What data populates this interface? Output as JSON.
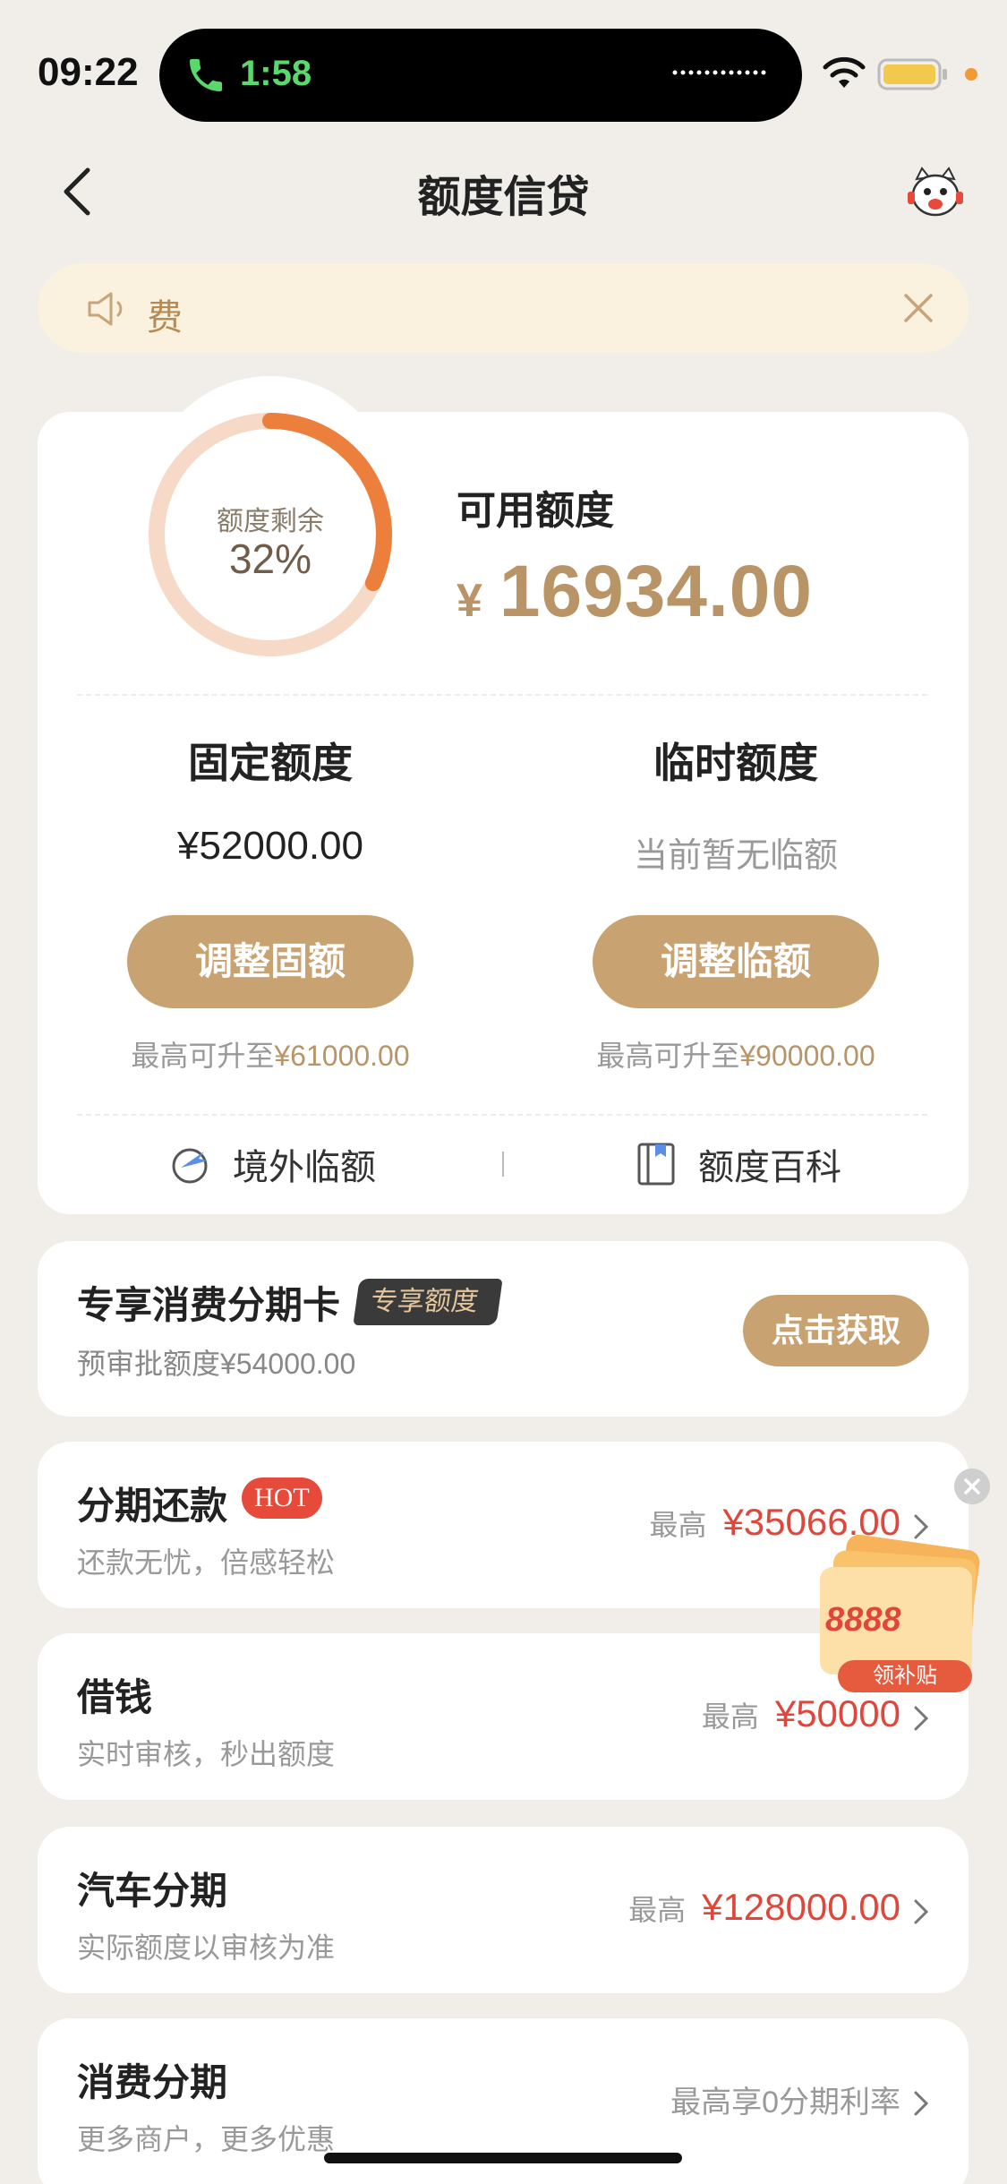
{
  "status_bar": {
    "time": "09:22",
    "call_duration": "1:58"
  },
  "header": {
    "title": "额度信贷"
  },
  "notice": {
    "text": "费"
  },
  "credit": {
    "ring_label": "额度剩余",
    "ring_percent_text": "32%",
    "ring_fraction": 0.32,
    "available_label": "可用额度",
    "available_currency": "¥",
    "available_amount": "16934.00",
    "fixed": {
      "title": "固定额度",
      "value": "¥52000.00",
      "button": "调整固额",
      "note_prefix": "最高可升至",
      "note_amount": "¥61000.00"
    },
    "temporary": {
      "title": "临时额度",
      "value": "当前暂无临额",
      "button": "调整临额",
      "note_prefix": "最高可升至",
      "note_amount": "¥90000.00"
    },
    "links": {
      "overseas": "境外临额",
      "wiki": "额度百科"
    }
  },
  "exclusive": {
    "title": "专享消费分期卡",
    "tag": "专享额度",
    "subtitle": "预审批额度¥54000.00",
    "button": "点击获取"
  },
  "rows": [
    {
      "title": "分期还款",
      "badge": "HOT",
      "subtitle": "还款无忧，倍感轻松",
      "prefix": "最高",
      "amount": "¥35066.00"
    },
    {
      "title": "借钱",
      "subtitle": "实时审核，秒出额度",
      "prefix": "最高",
      "amount": "¥50000"
    },
    {
      "title": "汽车分期",
      "subtitle": "实际额度以审核为准",
      "prefix": "最高",
      "amount": "¥128000.00"
    },
    {
      "title": "消费分期",
      "subtitle": "更多商户，更多优惠",
      "rate": "最高享0分期利率"
    }
  ],
  "floating": {
    "amount": "8888",
    "label": "领补贴"
  },
  "colors": {
    "gold": "#c9a271",
    "ring": "#ec7f3c",
    "ring_track": "#f6d9c7",
    "red": "#e0463a"
  }
}
